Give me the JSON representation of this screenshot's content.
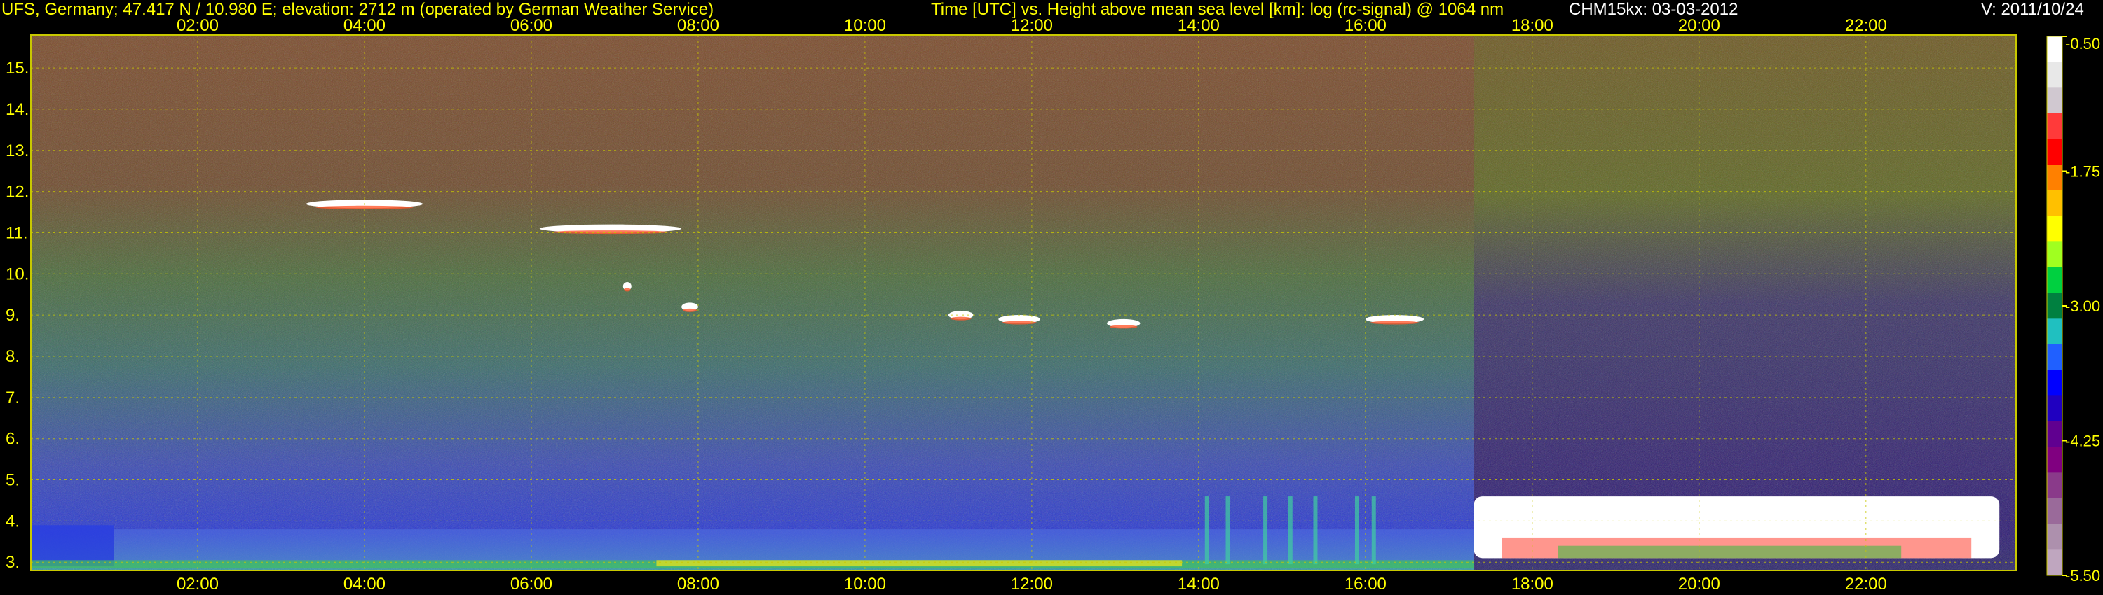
{
  "header": {
    "station": "UFS, Germany; 47.417 N / 10.980 E; elevation: 2712 m  (operated by German Weather Service)",
    "title": "Time [UTC] vs. Height above mean sea level [km]: log (rc-signal) @ 1064 nm",
    "instrument": "CHM15kx: 03-03-2012",
    "version": "V: 2011/10/24"
  },
  "colors": {
    "background": "#000000",
    "axis_text": "#ffff00",
    "grid": "#c8c800",
    "cloud": "#ffffff"
  },
  "chart_data": {
    "type": "heatmap",
    "title": "Time [UTC] vs. Height above mean sea level [km]: log (rc-signal) @ 1064 nm",
    "xlabel": "Time [UTC]",
    "ylabel": "Height above mean sea level [km]",
    "x_unit": "hours UTC",
    "xlim": [
      0,
      23.8
    ],
    "ylim": [
      2.8,
      15.8
    ],
    "x_ticks": [
      2,
      4,
      6,
      8,
      10,
      12,
      14,
      16,
      18,
      20,
      22
    ],
    "x_tick_labels": [
      "02:00",
      "04:00",
      "06:00",
      "08:00",
      "10:00",
      "12:00",
      "14:00",
      "16:00",
      "18:00",
      "20:00",
      "22:00"
    ],
    "y_ticks": [
      3,
      4,
      5,
      6,
      7,
      8,
      9,
      10,
      11,
      12,
      13,
      14,
      15
    ],
    "y_tick_labels": [
      "3.",
      "4.",
      "5.",
      "6.",
      "7.",
      "8.",
      "9.",
      "10.",
      "11.",
      "12.",
      "13.",
      "14.",
      "15."
    ],
    "grid": true,
    "colorbar": {
      "range": [
        -5.5,
        -0.5
      ],
      "ticks": [
        -0.5,
        -1.75,
        -3.0,
        -4.25,
        -5.5
      ],
      "tick_labels": [
        "-0.50",
        "-1.75",
        "-3.00",
        "-4.25",
        "-5.50"
      ],
      "colors": [
        "#ffffff",
        "#e8e8e8",
        "#d0c8d0",
        "#ff3a3a",
        "#ff0000",
        "#ff8000",
        "#ffc000",
        "#ffff00",
        "#a0ff20",
        "#00d040",
        "#008040",
        "#20c0c0",
        "#2060ff",
        "#0000ff",
        "#2000c0",
        "#600090",
        "#800080",
        "#8a3a8a",
        "#9a6a9a",
        "#ad90ad",
        "#bfa6bf"
      ]
    },
    "cloud_layers": [
      {
        "start": 3.3,
        "end": 4.7,
        "height": 11.7
      },
      {
        "start": 6.1,
        "end": 7.8,
        "height": 11.1
      },
      {
        "start": 7.1,
        "end": 7.2,
        "height": 9.7
      },
      {
        "start": 7.8,
        "end": 8.0,
        "height": 9.2
      },
      {
        "start": 11.0,
        "end": 11.3,
        "height": 9.0
      },
      {
        "start": 11.6,
        "end": 12.1,
        "height": 8.9
      },
      {
        "start": 12.9,
        "end": 13.3,
        "height": 8.8
      },
      {
        "start": 16.0,
        "end": 16.7,
        "height": 8.9
      },
      {
        "start": 17.3,
        "end": 23.6,
        "height_top": 4.6,
        "height_bottom": 3.1
      }
    ]
  }
}
